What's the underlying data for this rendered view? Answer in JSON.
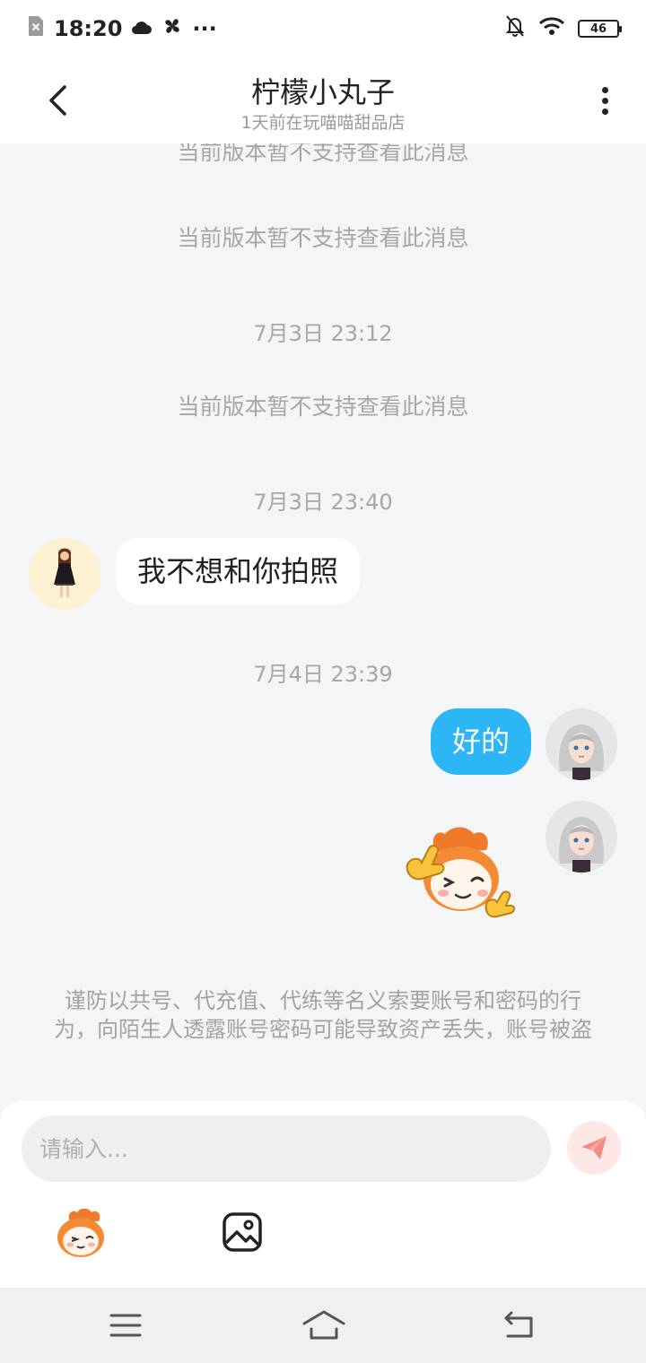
{
  "status_bar": {
    "time": "18:20",
    "dots": "···",
    "battery": "46",
    "icons": [
      "sim-error-icon",
      "cloud-icon",
      "pinwheel-icon",
      "bell-off-icon",
      "wifi-icon",
      "battery-icon"
    ]
  },
  "header": {
    "title": "柠檬小丸子",
    "subtitle": "1天前在玩喵喵甜品店",
    "back_icon": "chevron-left-icon",
    "more_icon": "more-vertical-icon"
  },
  "chat": {
    "system_message_partial": "当前版本暂不支持查看此消息",
    "system_message_1": "当前版本暂不支持查看此消息",
    "timestamp_1": "7月3日 23:12",
    "system_message_2": "当前版本暂不支持查看此消息",
    "timestamp_2": "7月3日 23:40",
    "incoming_message": "我不想和你拍照",
    "timestamp_3": "7月4日 23:39",
    "outgoing_message": "好的",
    "sticker": "thumbs-up-mascot-sticker",
    "warning": "谨防以共号、代充值、代练等名义索要账号和密码的行为，向陌生人透露账号密码可能导致资产丢失，账号被盗"
  },
  "composer": {
    "placeholder": "请输入...",
    "send_icon": "paper-plane-icon",
    "emoji_icon": "mascot-emoji-icon",
    "image_icon": "image-icon"
  },
  "nav_bar": {
    "icons": [
      "menu-icon",
      "home-icon",
      "back-icon"
    ]
  },
  "colors": {
    "outgoing_bubble": "#2db6f5",
    "send_button_bg": "#fde8e6",
    "send_icon": "#f28b82",
    "chat_bg": "#f4f5f7"
  }
}
